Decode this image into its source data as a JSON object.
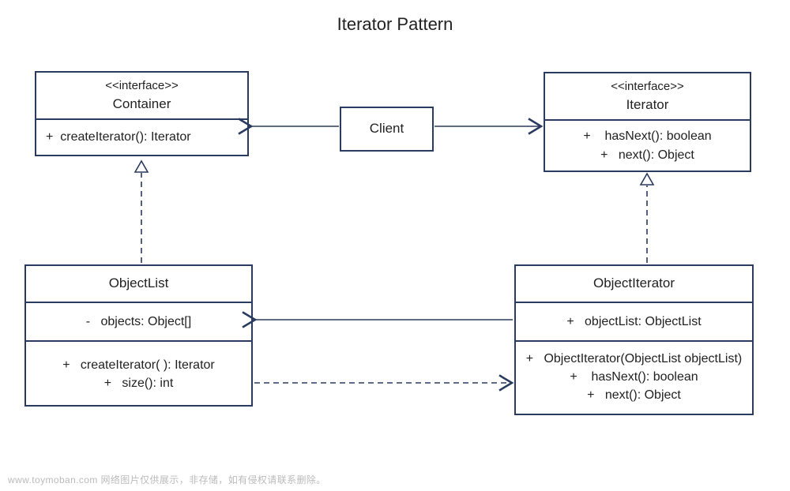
{
  "title": "Iterator Pattern",
  "watermark": "www.toymoban.com   网络图片仅供展示，非存储，如有侵权请联系删除。",
  "classes": {
    "container": {
      "stereotype": "<<interface>>",
      "name": "Container",
      "operations": [
        "+  createIterator(): Iterator"
      ]
    },
    "client": {
      "name": "Client"
    },
    "iterator": {
      "stereotype": "<<interface>>",
      "name": "Iterator",
      "operations": [
        "+    hasNext(): boolean",
        "+   next(): Object"
      ]
    },
    "objectList": {
      "name": "ObjectList",
      "attributes": [
        "-   objects: Object[]"
      ],
      "operations": [
        "+   createIterator( ): Iterator",
        "+   size(): int"
      ]
    },
    "objectIterator": {
      "name": "ObjectIterator",
      "attributes": [
        "+   objectList: ObjectList"
      ],
      "operations": [
        "+   ObjectIterator(ObjectList objectList)",
        "+    hasNext(): boolean",
        "+   next(): Object"
      ]
    }
  },
  "relationships": [
    {
      "from": "Client",
      "to": "Container",
      "type": "association",
      "arrow": "open"
    },
    {
      "from": "Client",
      "to": "Iterator",
      "type": "association",
      "arrow": "open"
    },
    {
      "from": "ObjectList",
      "to": "Container",
      "type": "realization",
      "arrow": "hollow-triangle",
      "style": "dashed"
    },
    {
      "from": "ObjectIterator",
      "to": "Iterator",
      "type": "realization",
      "arrow": "hollow-triangle",
      "style": "dashed"
    },
    {
      "from": "ObjectIterator",
      "to": "ObjectList",
      "type": "association",
      "arrow": "open"
    },
    {
      "from": "ObjectList",
      "to": "ObjectIterator",
      "type": "dependency",
      "arrow": "open",
      "style": "dashed"
    }
  ]
}
